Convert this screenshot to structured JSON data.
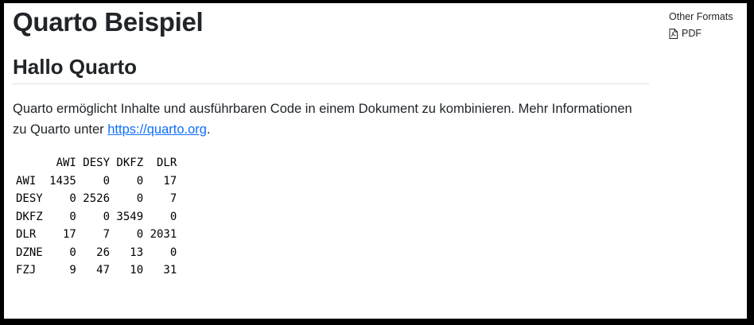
{
  "doc": {
    "title": "Quarto Beispiel",
    "section_heading": "Hallo Quarto",
    "paragraph_text": "Quarto ermöglicht Inhalte und ausführbaren Code in einem Dokument zu kombinieren. Mehr Informationen zu Quarto unter ",
    "link_text": "https://quarto.org",
    "paragraph_end": "."
  },
  "output_table": {
    "columns": [
      "AWI",
      "DESY",
      "DKFZ",
      "DLR"
    ],
    "rows": [
      {
        "label": "AWI",
        "values": [
          1435,
          0,
          0,
          17
        ]
      },
      {
        "label": "DESY",
        "values": [
          0,
          2526,
          0,
          7
        ]
      },
      {
        "label": "DKFZ",
        "values": [
          0,
          0,
          3549,
          0
        ]
      },
      {
        "label": "DLR",
        "values": [
          17,
          7,
          0,
          2031
        ]
      },
      {
        "label": "DZNE",
        "values": [
          0,
          26,
          13,
          0
        ]
      },
      {
        "label": "FZJ",
        "values": [
          9,
          47,
          10,
          31
        ]
      }
    ]
  },
  "sidebar": {
    "heading": "Other Formats",
    "formats": [
      {
        "label": "PDF",
        "icon": "file-pdf-icon"
      }
    ]
  }
}
